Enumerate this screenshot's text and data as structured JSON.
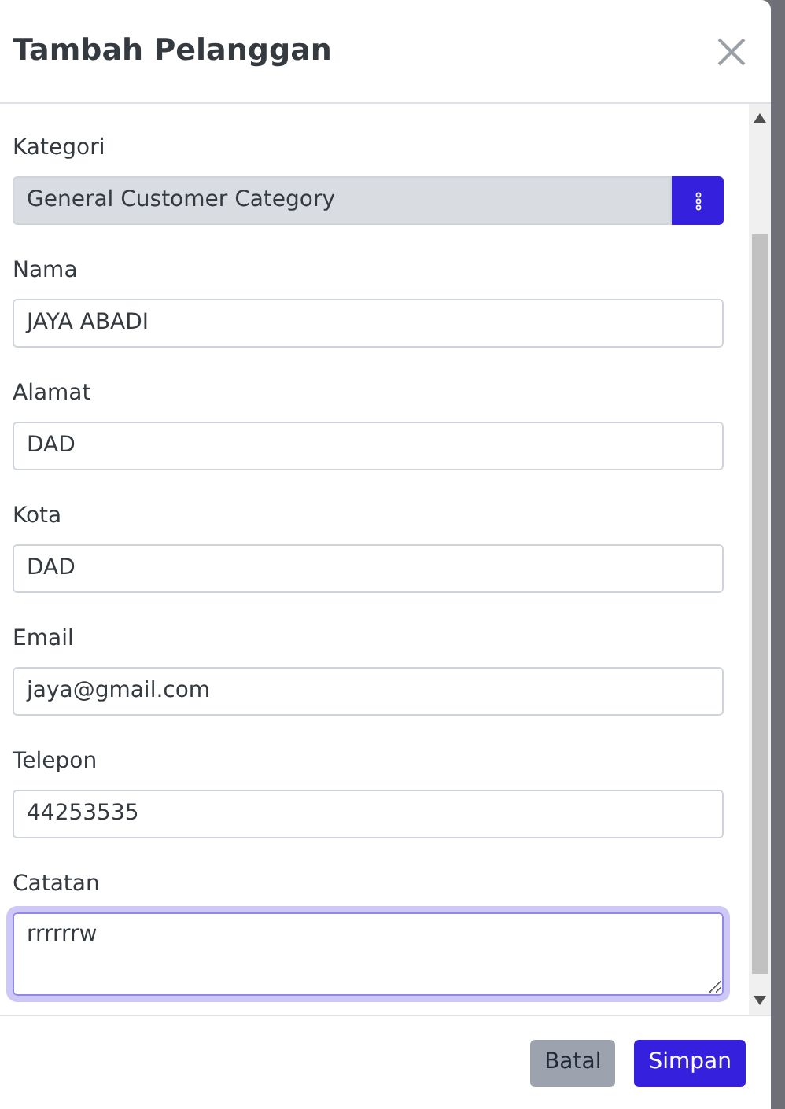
{
  "dialog": {
    "title": "Tambah Pelanggan"
  },
  "fields": [
    {
      "kind": "picker",
      "label": "Kategori",
      "value": "General Customer Category",
      "focused": false
    },
    {
      "kind": "text",
      "label": "Nama",
      "value": "JAYA ABADI",
      "focused": false
    },
    {
      "kind": "text",
      "label": "Alamat",
      "value": "DAD",
      "focused": false
    },
    {
      "kind": "text",
      "label": "Kota",
      "value": "DAD",
      "focused": false
    },
    {
      "kind": "text",
      "label": "Email",
      "value": "jaya@gmail.com",
      "focused": false
    },
    {
      "kind": "text",
      "label": "Telepon",
      "value": "44253535",
      "focused": false
    },
    {
      "kind": "textarea",
      "label": "Catatan",
      "value": "rrrrrrw",
      "focused": true
    }
  ],
  "buttons": [
    {
      "kind": "secondary",
      "label": "Batal"
    },
    {
      "kind": "primary",
      "label": "Simpan"
    }
  ]
}
